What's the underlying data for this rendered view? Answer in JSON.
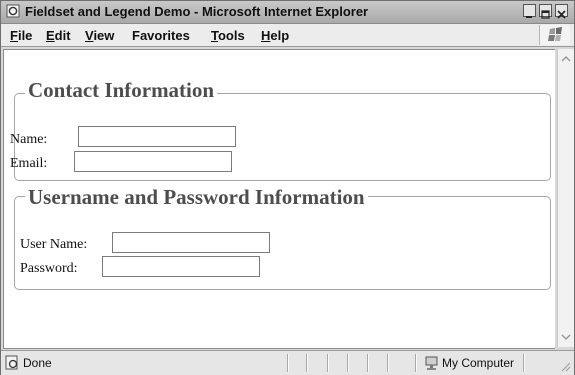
{
  "window": {
    "title": "Fieldset and Legend Demo - Microsoft Internet Explorer",
    "icon": "ie-page-icon",
    "controls": [
      "minimize-icon",
      "restore-icon",
      "close-icon"
    ]
  },
  "menubar": {
    "items": [
      {
        "label": "File",
        "accel": "F",
        "rest": "ile"
      },
      {
        "label": "Edit",
        "accel": "E",
        "rest": "dit"
      },
      {
        "label": "View",
        "accel": "V",
        "rest": "iew"
      },
      {
        "label": "Favorites",
        "accel": "",
        "rest": "Favorites"
      },
      {
        "label": "Tools",
        "accel": "T",
        "rest": "ools"
      },
      {
        "label": "Help",
        "accel": "H",
        "rest": "elp"
      }
    ]
  },
  "page": {
    "contact": {
      "legend": "Contact Information",
      "fields": [
        {
          "label": "Name:",
          "value": ""
        },
        {
          "label": "Email:",
          "value": ""
        }
      ]
    },
    "credentials": {
      "legend": "Username and Password Information",
      "fields": [
        {
          "label": "User Name:",
          "value": ""
        },
        {
          "label": "Password:",
          "value": ""
        }
      ]
    }
  },
  "statusbar": {
    "status": "Done",
    "zone": "My Computer",
    "status_icon": "ie-page-icon",
    "zone_icon": "computer-icon"
  }
}
